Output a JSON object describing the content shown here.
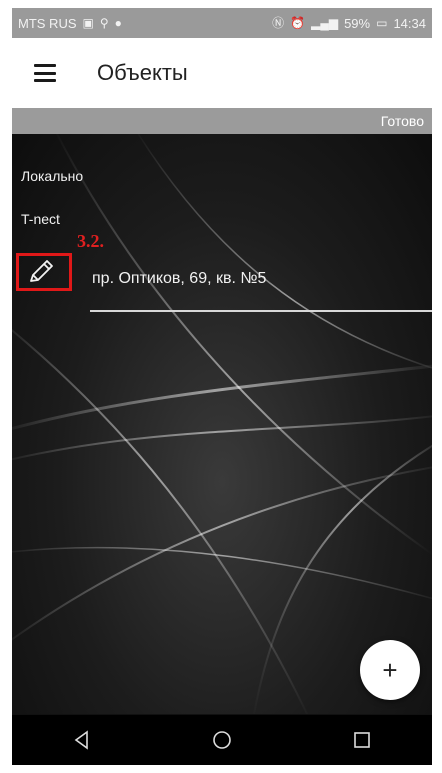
{
  "status_bar": {
    "carrier": "MTS RUS",
    "battery": "59%",
    "time": "14:34",
    "left_icons": [
      "image-icon",
      "search-icon",
      "chat-bubble-icon"
    ],
    "right_icons": [
      "nfc-icon",
      "alarm-icon",
      "signal-icon"
    ]
  },
  "app_bar": {
    "title": "Объекты",
    "menu_icon": "hamburger-menu-icon"
  },
  "done_bar": {
    "label": "Готово"
  },
  "list": {
    "section_local": "Локально",
    "section_tnest": "T-nect",
    "items": [
      {
        "icon": "pencil-icon",
        "address": "пр. Оптиков, 69, кв. №5"
      }
    ]
  },
  "annotation": {
    "label": "3.2.",
    "color": "#e02020"
  },
  "fab": {
    "label": "+"
  },
  "nav_bar": {
    "buttons": [
      "back-triangle-icon",
      "home-circle-icon",
      "recents-square-icon"
    ]
  }
}
